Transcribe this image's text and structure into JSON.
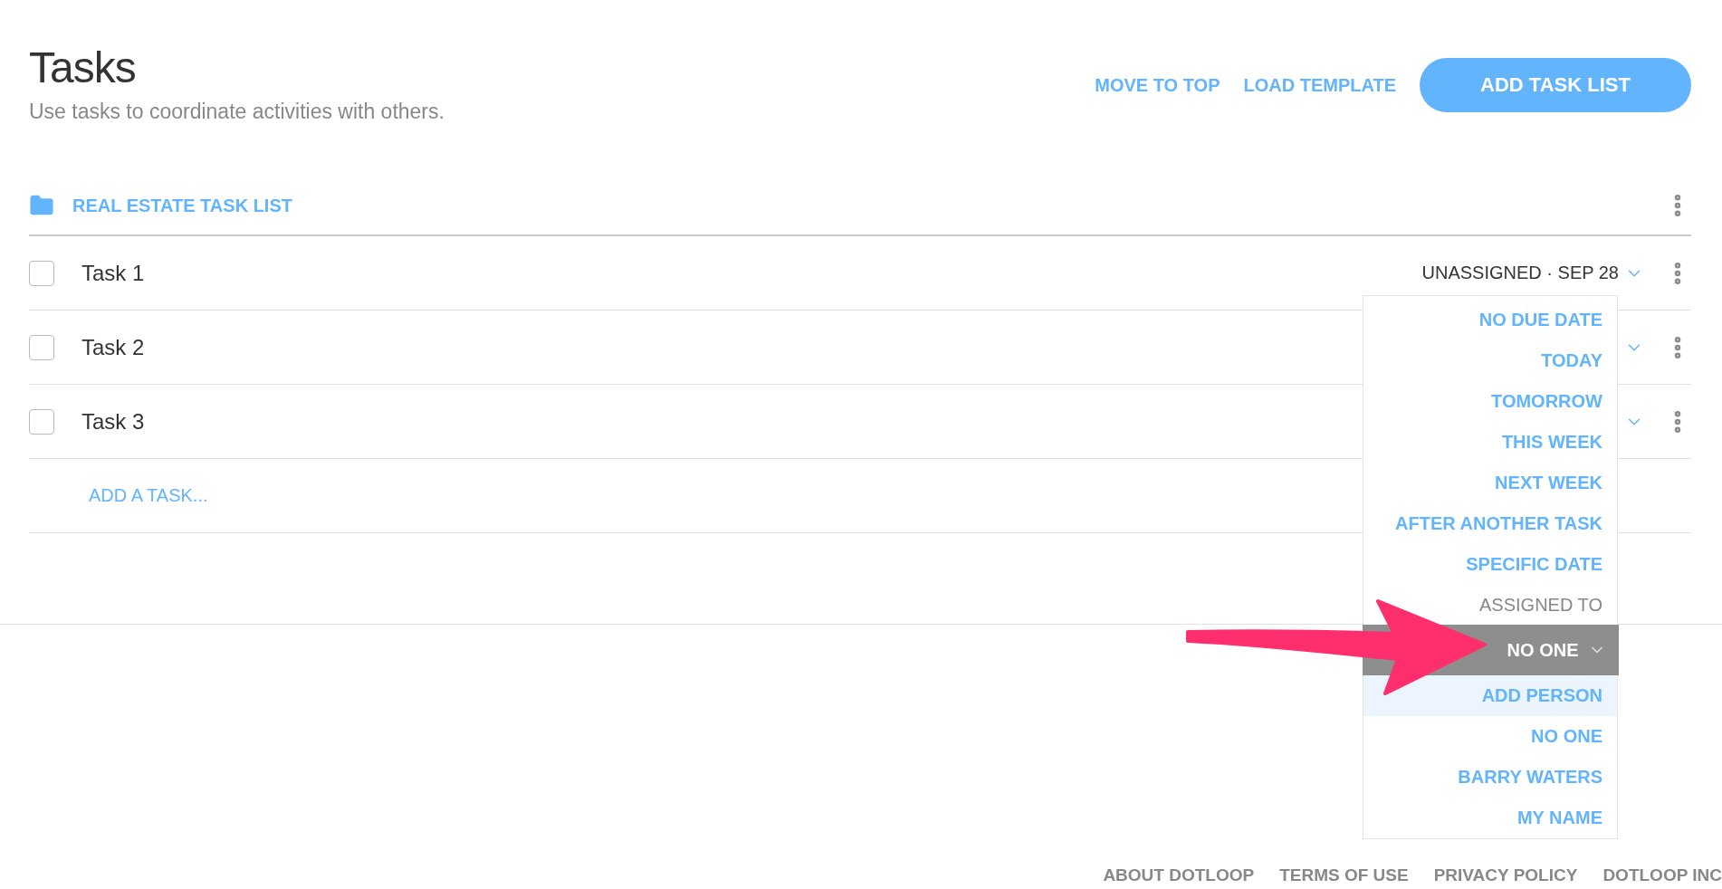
{
  "header": {
    "title": "Tasks",
    "subtitle": "Use tasks to coordinate activities with others.",
    "actions": [
      "MOVE TO TOP",
      "LOAD TEMPLATE"
    ],
    "primary_button": "ADD TASK LIST"
  },
  "task_list": {
    "name": "REAL ESTATE TASK LIST",
    "tasks": [
      {
        "label": "Task 1",
        "checked": false,
        "meta": "UNASSIGNED · SEP 28"
      },
      {
        "label": "Task 2",
        "checked": false
      },
      {
        "label": "Task 3",
        "checked": false
      }
    ],
    "add_task": "ADD A TASK..."
  },
  "dropdown": {
    "due_options": [
      {
        "label": "NO DUE DATE",
        "highlighted": false
      },
      {
        "label": "TODAY",
        "highlighted": false
      },
      {
        "label": "TOMORROW",
        "highlighted": false
      },
      {
        "label": "THIS WEEK",
        "highlighted": false
      },
      {
        "label": "NEXT WEEK",
        "highlighted": false
      },
      {
        "label": "AFTER ANOTHER TASK",
        "highlighted": false
      },
      {
        "label": "SPECIFIC DATE",
        "highlighted": false
      }
    ],
    "assigned_heading": "ASSIGNED TO",
    "assigned_select": "NO ONE",
    "people": [
      {
        "label": "ADD PERSON",
        "highlighted": true
      },
      {
        "label": "NO ONE",
        "highlighted": false
      },
      {
        "label": "BARRY WATERS",
        "highlighted": false
      },
      {
        "label": "MY NAME",
        "highlighted": false
      }
    ]
  },
  "footer": [
    "ABOUT DOTLOOP",
    "TERMS OF USE",
    "PRIVACY POLICY",
    "DOTLOOP INC"
  ]
}
